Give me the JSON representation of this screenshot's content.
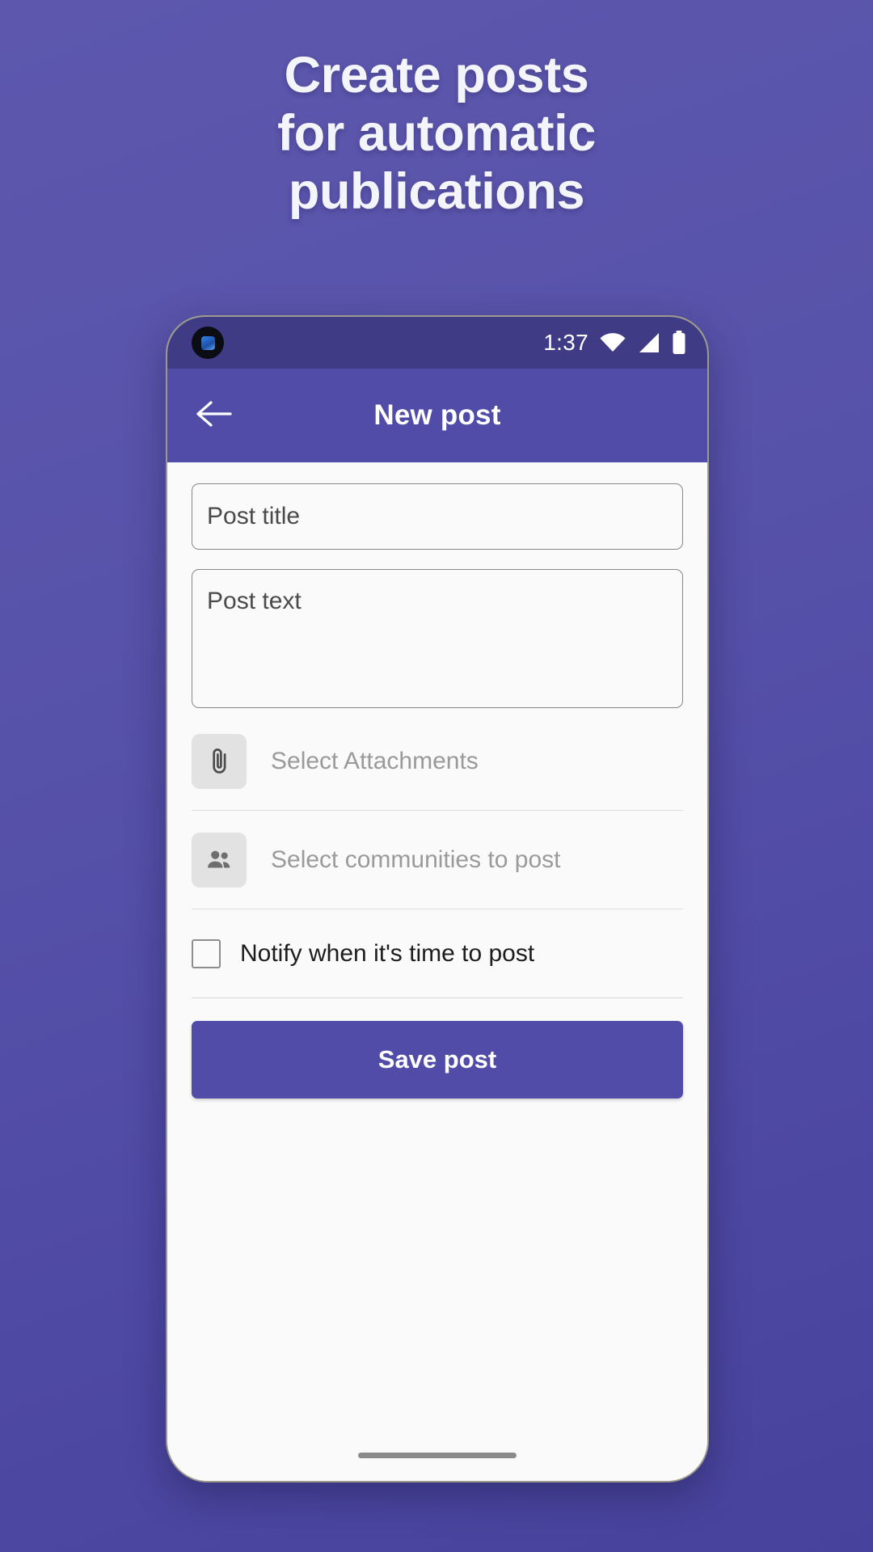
{
  "promo": {
    "lines": [
      "Create posts",
      "for automatic",
      "publications"
    ]
  },
  "colors": {
    "background_top": "#5d58ae",
    "background_bottom": "#47439c",
    "status_bar": "#3f3c85",
    "app_bar": "#504ca8",
    "accent": "#504ca8",
    "screen_bg": "#fafafa",
    "placeholder_text": "#9a9a9a",
    "divider": "#dddddd"
  },
  "status_bar": {
    "time": "1:37",
    "icons": [
      "wifi-icon",
      "cellular-signal-icon",
      "battery-icon"
    ],
    "camera": "front-camera-punch-hole"
  },
  "app_bar": {
    "back_icon": "arrow-left-icon",
    "title": "New post"
  },
  "form": {
    "title_field": {
      "placeholder": "Post title",
      "value": ""
    },
    "text_field": {
      "placeholder": "Post text",
      "value": ""
    },
    "attachments_row": {
      "icon": "paperclip-icon",
      "label": "Select Attachments"
    },
    "communities_row": {
      "icon": "people-icon",
      "label": "Select communities to post"
    },
    "notify_row": {
      "label": "Notify when it's time to post",
      "checked": false
    },
    "save_button": {
      "label": "Save post"
    }
  },
  "navigation": {
    "gesture_bar": "home-gesture-indicator"
  }
}
